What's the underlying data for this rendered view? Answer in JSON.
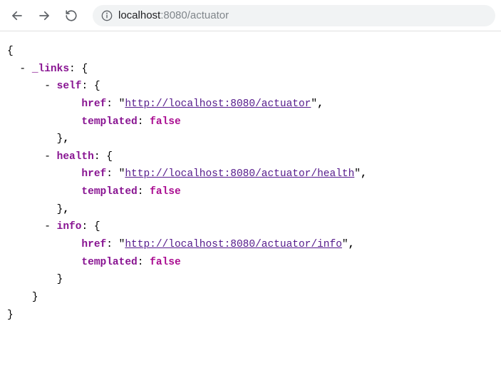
{
  "toolbar": {
    "url_host": "localhost",
    "url_port_path": ":8080/actuator"
  },
  "json": {
    "links_key": "_links",
    "entries": [
      {
        "name": "self",
        "href_key": "href",
        "href_value": "http://localhost:8080/actuator",
        "templated_key": "templated",
        "templated_value": "false"
      },
      {
        "name": "health",
        "href_key": "href",
        "href_value": "http://localhost:8080/actuator/health",
        "templated_key": "templated",
        "templated_value": "false"
      },
      {
        "name": "info",
        "href_key": "href",
        "href_value": "http://localhost:8080/actuator/info",
        "templated_key": "templated",
        "templated_value": "false"
      }
    ]
  }
}
